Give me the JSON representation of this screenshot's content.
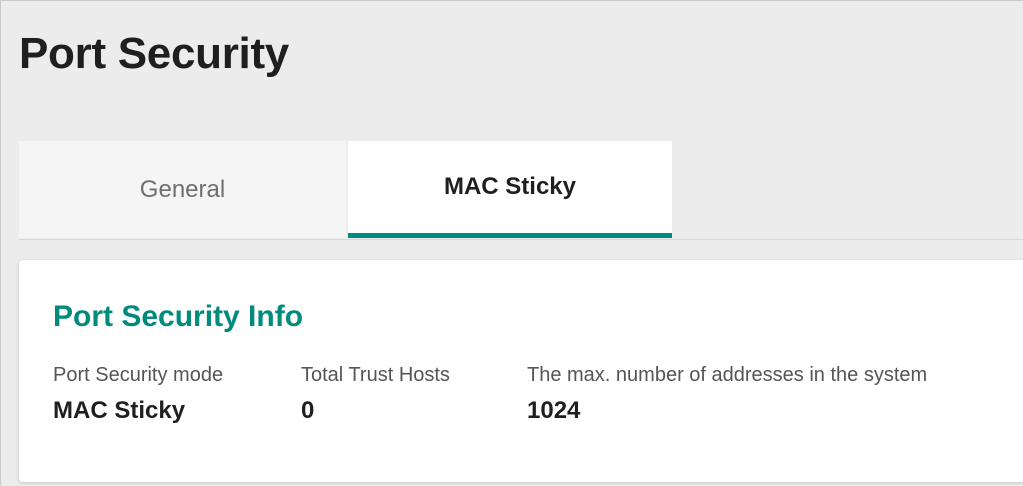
{
  "page": {
    "title": "Port Security"
  },
  "tabs": [
    {
      "label": "General",
      "active": false
    },
    {
      "label": "MAC Sticky",
      "active": true
    }
  ],
  "info_card": {
    "title": "Port Security Info",
    "fields": [
      {
        "label": "Port Security mode",
        "value": "MAC Sticky"
      },
      {
        "label": "Total Trust Hosts",
        "value": "0"
      },
      {
        "label": "The max. number of addresses in the system",
        "value": "1024"
      }
    ]
  },
  "colors": {
    "accent": "#008b7d",
    "page_background": "#ececec",
    "card_background": "#ffffff",
    "inactive_tab_background": "#f5f5f5"
  }
}
